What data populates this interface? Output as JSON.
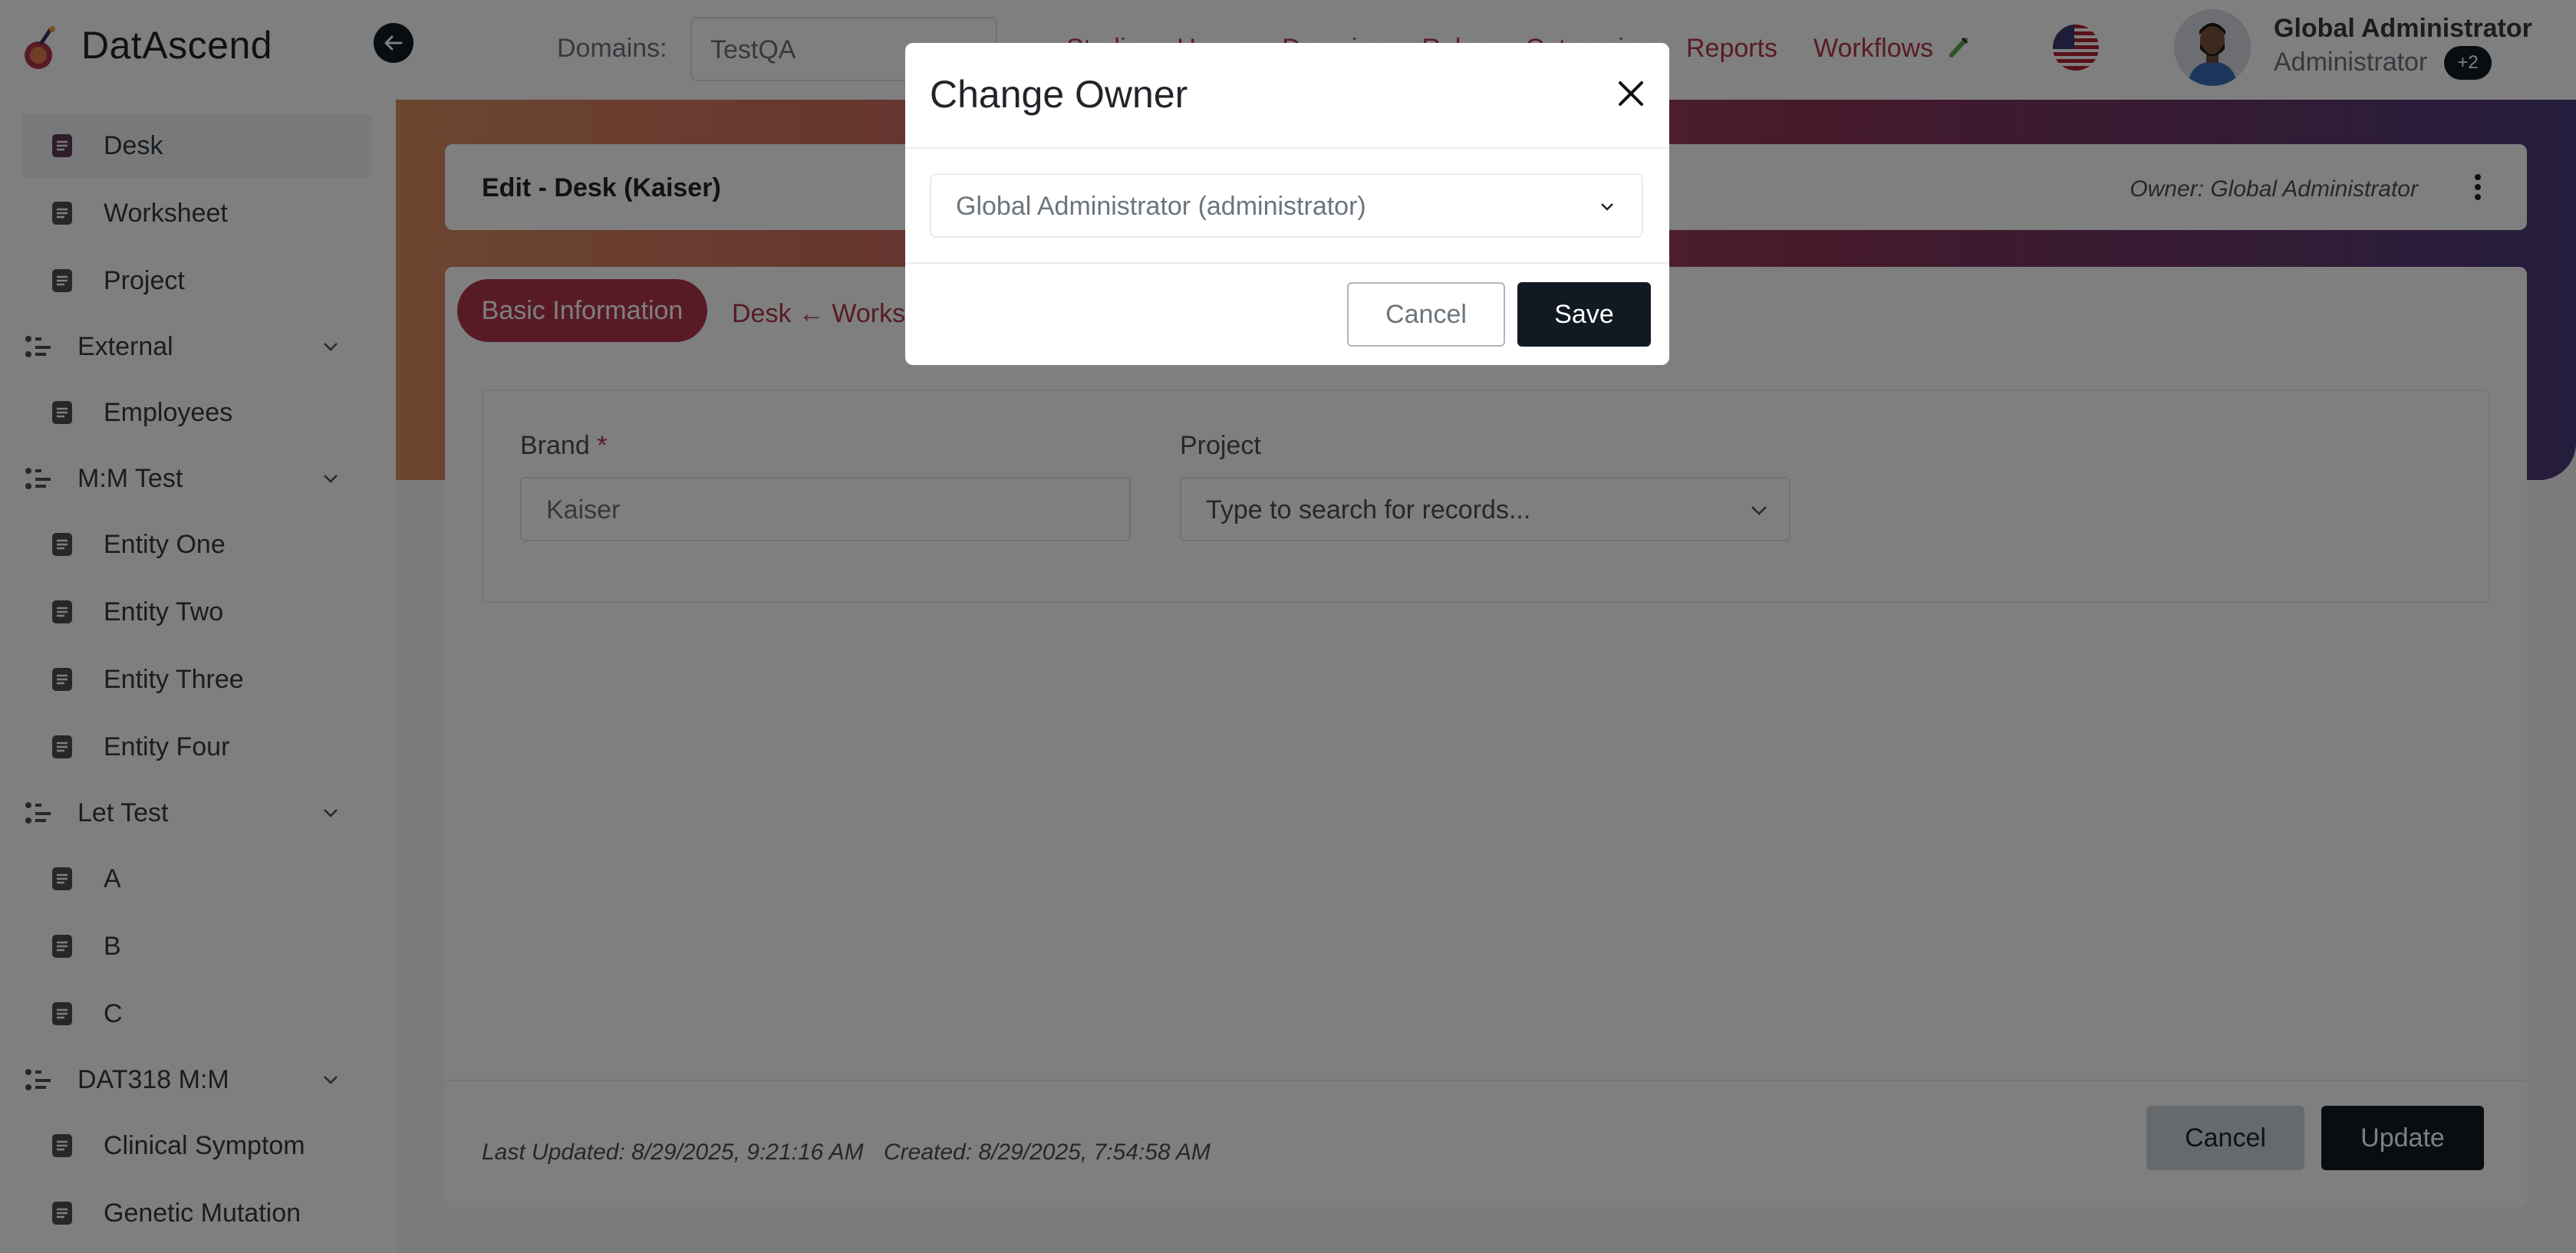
{
  "app": {
    "name": "DatAscend"
  },
  "header": {
    "domains_label": "Domains:",
    "domains_value": "TestQA",
    "nav": [
      {
        "label": "Studio"
      },
      {
        "label": "Users"
      },
      {
        "label": "Domains"
      },
      {
        "label": "Roles"
      },
      {
        "label": "Categories"
      }
    ],
    "reports_label": "Reports",
    "workflows_label": "Workflows",
    "user_name": "Global Administrator",
    "user_role": "Administrator",
    "user_badge": "+2"
  },
  "sidebar": {
    "items": [
      {
        "type": "item",
        "label": "Desk",
        "active": true
      },
      {
        "type": "item",
        "label": "Worksheet"
      },
      {
        "type": "item",
        "label": "Project"
      },
      {
        "type": "group",
        "label": "External"
      },
      {
        "type": "item",
        "label": "Employees"
      },
      {
        "type": "group",
        "label": "M:M Test"
      },
      {
        "type": "item",
        "label": "Entity One"
      },
      {
        "type": "item",
        "label": "Entity Two"
      },
      {
        "type": "item",
        "label": "Entity Three"
      },
      {
        "type": "item",
        "label": "Entity Four"
      },
      {
        "type": "group",
        "label": "Let Test"
      },
      {
        "type": "item",
        "label": "A"
      },
      {
        "type": "item",
        "label": "B"
      },
      {
        "type": "item",
        "label": "C"
      },
      {
        "type": "group",
        "label": "DAT318 M:M"
      },
      {
        "type": "item",
        "label": "Clinical Symptom"
      },
      {
        "type": "item",
        "label": "Genetic Mutation"
      }
    ]
  },
  "main": {
    "edit_title": "Edit - Desk (Kaiser)",
    "owner_text": "Owner: Global Administrator",
    "tabs": [
      {
        "label": "Basic Information"
      },
      {
        "label": "Desk ← Worksheet"
      }
    ],
    "form": {
      "brand_label": "Brand",
      "brand_required": "*",
      "brand_value": "Kaiser",
      "project_label": "Project",
      "project_placeholder": "Type to search for records..."
    },
    "last_updated": "Last Updated: 8/29/2025, 9:21:16 AM",
    "created": "Created: 8/29/2025, 7:54:58 AM",
    "cancel_label": "Cancel",
    "update_label": "Update"
  },
  "modal": {
    "title": "Change Owner",
    "owner_select_value": "Global Administrator (administrator)",
    "cancel_label": "Cancel",
    "save_label": "Save"
  },
  "colors": {
    "accent": "#b0364a",
    "dark": "#111a22",
    "banner_start": "#d98c5e",
    "banner_end": "#4a3a7a"
  }
}
